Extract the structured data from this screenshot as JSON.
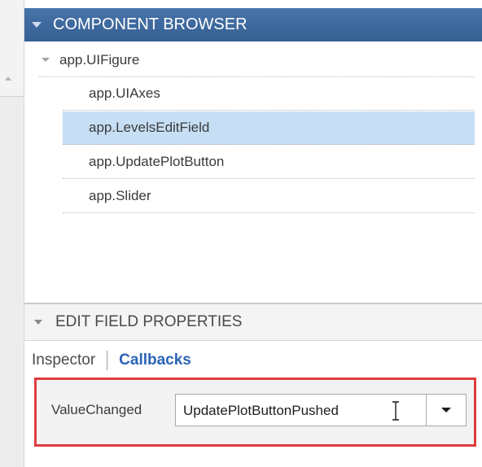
{
  "component_browser": {
    "title": "COMPONENT BROWSER",
    "root": "app.UIFigure",
    "children": [
      {
        "label": "app.UIAxes",
        "selected": false
      },
      {
        "label": "app.LevelsEditField",
        "selected": true
      },
      {
        "label": "app.UpdatePlotButton",
        "selected": false
      },
      {
        "label": "app.Slider",
        "selected": false
      }
    ]
  },
  "properties_panel": {
    "title": "EDIT FIELD PROPERTIES",
    "tabs": {
      "inspector": "Inspector",
      "callbacks": "Callbacks"
    },
    "callback": {
      "label": "ValueChanged",
      "value": "UpdatePlotButtonPushed"
    }
  },
  "colors": {
    "header_blue": "#3f6a9f",
    "selection_blue": "#c6dff4",
    "callbacks_tab": "#2a64b8",
    "highlight_red": "#de3c3c"
  },
  "icons": {
    "collapse": "triangle-down-icon",
    "dropdown": "chevron-down-icon",
    "cursor": "text-cursor-icon"
  }
}
